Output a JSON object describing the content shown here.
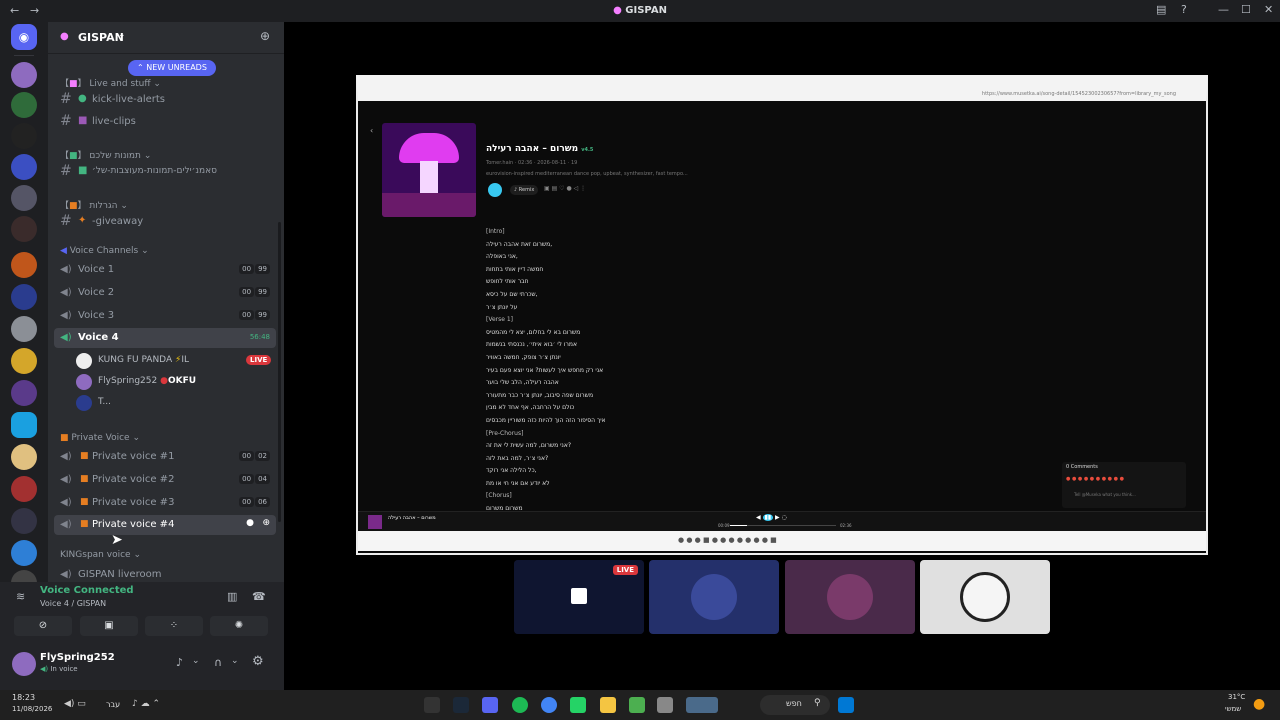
{
  "window": {
    "title": "GISPAN"
  },
  "guild": {
    "name": "GISPAN",
    "new_unreads": "NEW UNREADS"
  },
  "categories": {
    "live": "Live and stuff",
    "pics": "תמונות שלכם",
    "giveaways": "הגרלות",
    "voice": "Voice Channels",
    "private": "Private Voice",
    "kingspan": "KINGspan voice"
  },
  "channels": {
    "kick_live_alerts": "kick-live-alerts",
    "live_clips": "live-clips",
    "pics": "סאמנ׳ילים-תמונות-מעוצבות-של׳",
    "giveaway": "-giveaway"
  },
  "voice_channels": [
    {
      "name": "Voice 1",
      "users": "00",
      "limit": "99"
    },
    {
      "name": "Voice 2",
      "users": "00",
      "limit": "99"
    },
    {
      "name": "Voice 3",
      "users": "00",
      "limit": "99"
    },
    {
      "name": "Voice 4",
      "timer": "56:48"
    }
  ],
  "voice4_members": [
    {
      "name": "KUNG FU PANDA",
      "tag": "IL",
      "live": "LIVE"
    },
    {
      "name": "FlySpring252",
      "tag": "OKFU"
    },
    {
      "name": "T..."
    }
  ],
  "private_voice": [
    {
      "name": "Private voice #1",
      "users": "00",
      "limit": "02"
    },
    {
      "name": "Private voice #2",
      "users": "00",
      "limit": "04"
    },
    {
      "name": "Private voice #3",
      "users": "00",
      "limit": "06"
    },
    {
      "name": "Private voice #4"
    }
  ],
  "kingspan_room": "GISPAN liveroom",
  "voice_status": {
    "title": "Voice Connected",
    "subtitle": "Voice 4 / GISPAN"
  },
  "user": {
    "name": "FlySpring252",
    "status": "In voice"
  },
  "stream": {
    "song_title": "משרום – אהבה רעילה",
    "tag": "v4.5",
    "meta_line": "Tomer.hain · 02:36 · 2026-08-11 · 19",
    "style_line": "eurovision-inspired mediterranean dance pop, upbeat, synthesizer, fast tempo...",
    "remix_label": "Remix",
    "comments_label": "0 Comments",
    "comment_placeholder": "Tell @Museka what you think...",
    "player_title": "משרום – אהבה רעילה",
    "player_time_left": "00:09",
    "player_time_right": "02:36",
    "url": "https://www.musetka.ai/song-detail/15452300230657?from=library_my_song",
    "lyrics": [
      "[Intro]",
      "משרום זאת אהבה רעילה,",
      "אני באופלה,",
      "חמשה דיין אותי בתחות",
      "חבר אותי לחופש",
      "שכרתי שם על כיסא,",
      "על יונתן צ׳ר",
      "[Verse 1]",
      "משרום בא לי בחלום, יצא לי מהמטיס",
      "אמרו לי ׳בוא איתי׳, נכנסתי בנשמות",
      "יונתן צ׳ר צופק, חמשה באוויר",
      "אני רק מחפש איך לעשות? אני יוצא פעם בעיר",
      "אהבה רעילה, הלב שלי בוער",
      "משרום שפה סיבוב, יונתן צ׳ר כבר מתעורר",
      "כולם על הרחבה, אף אחד לא מבין",
      "איך הסיפור הזה הוך להיות כזה משוריין מכבסים",
      "[Pre-Chorus]",
      "אני משרום, למה עשית לי את זה?",
      "אני צ׳ר, למה באת לזה?",
      "כל הלילה אני רוקד,",
      "לא יודע אם אני חי או מת",
      "[Chorus]",
      "משרום משרום"
    ]
  },
  "participants": {
    "live": "LIVE"
  },
  "taskbar": {
    "time": "18:23",
    "date": "11/08/2026",
    "search": "חפש",
    "weather": "31°C",
    "weather_sub": "שמשי",
    "lang": "עבר"
  }
}
